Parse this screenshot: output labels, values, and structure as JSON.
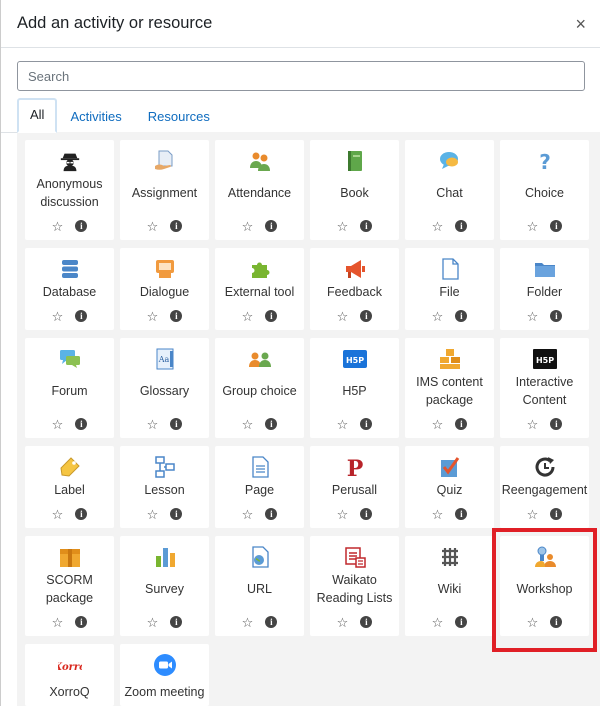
{
  "dialog": {
    "title": "Add an activity or resource",
    "close_symbol": "×"
  },
  "search": {
    "placeholder": "Search"
  },
  "tabs": [
    {
      "label": "All",
      "active": true
    },
    {
      "label": "Activities",
      "active": false
    },
    {
      "label": "Resources",
      "active": false
    }
  ],
  "items": [
    {
      "label": "Anonymous discussion",
      "icon": "anonymous-icon"
    },
    {
      "label": "Assignment",
      "icon": "assignment-icon"
    },
    {
      "label": "Attendance",
      "icon": "attendance-icon"
    },
    {
      "label": "Book",
      "icon": "book-icon"
    },
    {
      "label": "Chat",
      "icon": "chat-icon"
    },
    {
      "label": "Choice",
      "icon": "choice-icon"
    },
    {
      "label": "Database",
      "icon": "database-icon"
    },
    {
      "label": "Dialogue",
      "icon": "dialogue-icon"
    },
    {
      "label": "External tool",
      "icon": "puzzle-icon"
    },
    {
      "label": "Feedback",
      "icon": "megaphone-icon"
    },
    {
      "label": "File",
      "icon": "file-icon"
    },
    {
      "label": "Folder",
      "icon": "folder-icon"
    },
    {
      "label": "Forum",
      "icon": "forum-icon"
    },
    {
      "label": "Glossary",
      "icon": "glossary-icon"
    },
    {
      "label": "Group choice",
      "icon": "group-choice-icon"
    },
    {
      "label": "H5P",
      "icon": "h5p-icon",
      "icon_text": "H5P"
    },
    {
      "label": "IMS content package",
      "icon": "ims-package-icon"
    },
    {
      "label": "Interactive Content",
      "icon": "interactive-content-icon",
      "icon_text": "H5P"
    },
    {
      "label": "Label",
      "icon": "label-tag-icon"
    },
    {
      "label": "Lesson",
      "icon": "lesson-icon"
    },
    {
      "label": "Page",
      "icon": "page-icon"
    },
    {
      "label": "Perusall",
      "icon": "perusall-icon",
      "icon_text": "P"
    },
    {
      "label": "Quiz",
      "icon": "quiz-icon"
    },
    {
      "label": "Reengagement",
      "icon": "reengagement-icon"
    },
    {
      "label": "SCORM package",
      "icon": "scorm-package-icon"
    },
    {
      "label": "Survey",
      "icon": "survey-icon"
    },
    {
      "label": "URL",
      "icon": "url-icon"
    },
    {
      "label": "Waikato Reading Lists",
      "icon": "reading-lists-icon"
    },
    {
      "label": "Wiki",
      "icon": "wiki-icon"
    },
    {
      "label": "Workshop",
      "icon": "workshop-icon"
    },
    {
      "label": "XorroQ",
      "icon": "xorroq-icon",
      "icon_text": "Xorro"
    },
    {
      "label": "Zoom meeting",
      "icon": "zoom-icon"
    }
  ],
  "item_actions": {
    "star_symbol": "☆",
    "info_symbol": "i"
  },
  "colors": {
    "link": "#0f6cbf",
    "highlight_border": "#e01f26",
    "grid_background": "#f3f3f3"
  }
}
